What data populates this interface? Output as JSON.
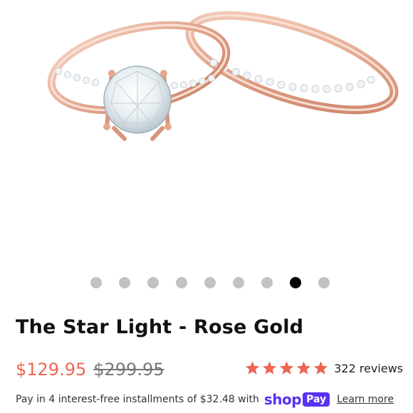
{
  "product": {
    "title": "The Star Light - Rose Gold",
    "price": "$129.95",
    "compare_price": "$299.95",
    "rating": 5,
    "review_count": "322 reviews",
    "image_icon": "rose-gold-bridal-ring-set"
  },
  "carousel": {
    "total_slides": 9,
    "active_index": 7
  },
  "installments": {
    "text": "Pay in 4 interest-free installments of $32.48 with",
    "shop_label": "shop",
    "pay_label": "Pay",
    "learn_more": "Learn more"
  },
  "colors": {
    "price": "#ef6552",
    "star": "#ef6552",
    "shop_pay": "#5a31f4",
    "rose_gold": "#e8b49e"
  }
}
